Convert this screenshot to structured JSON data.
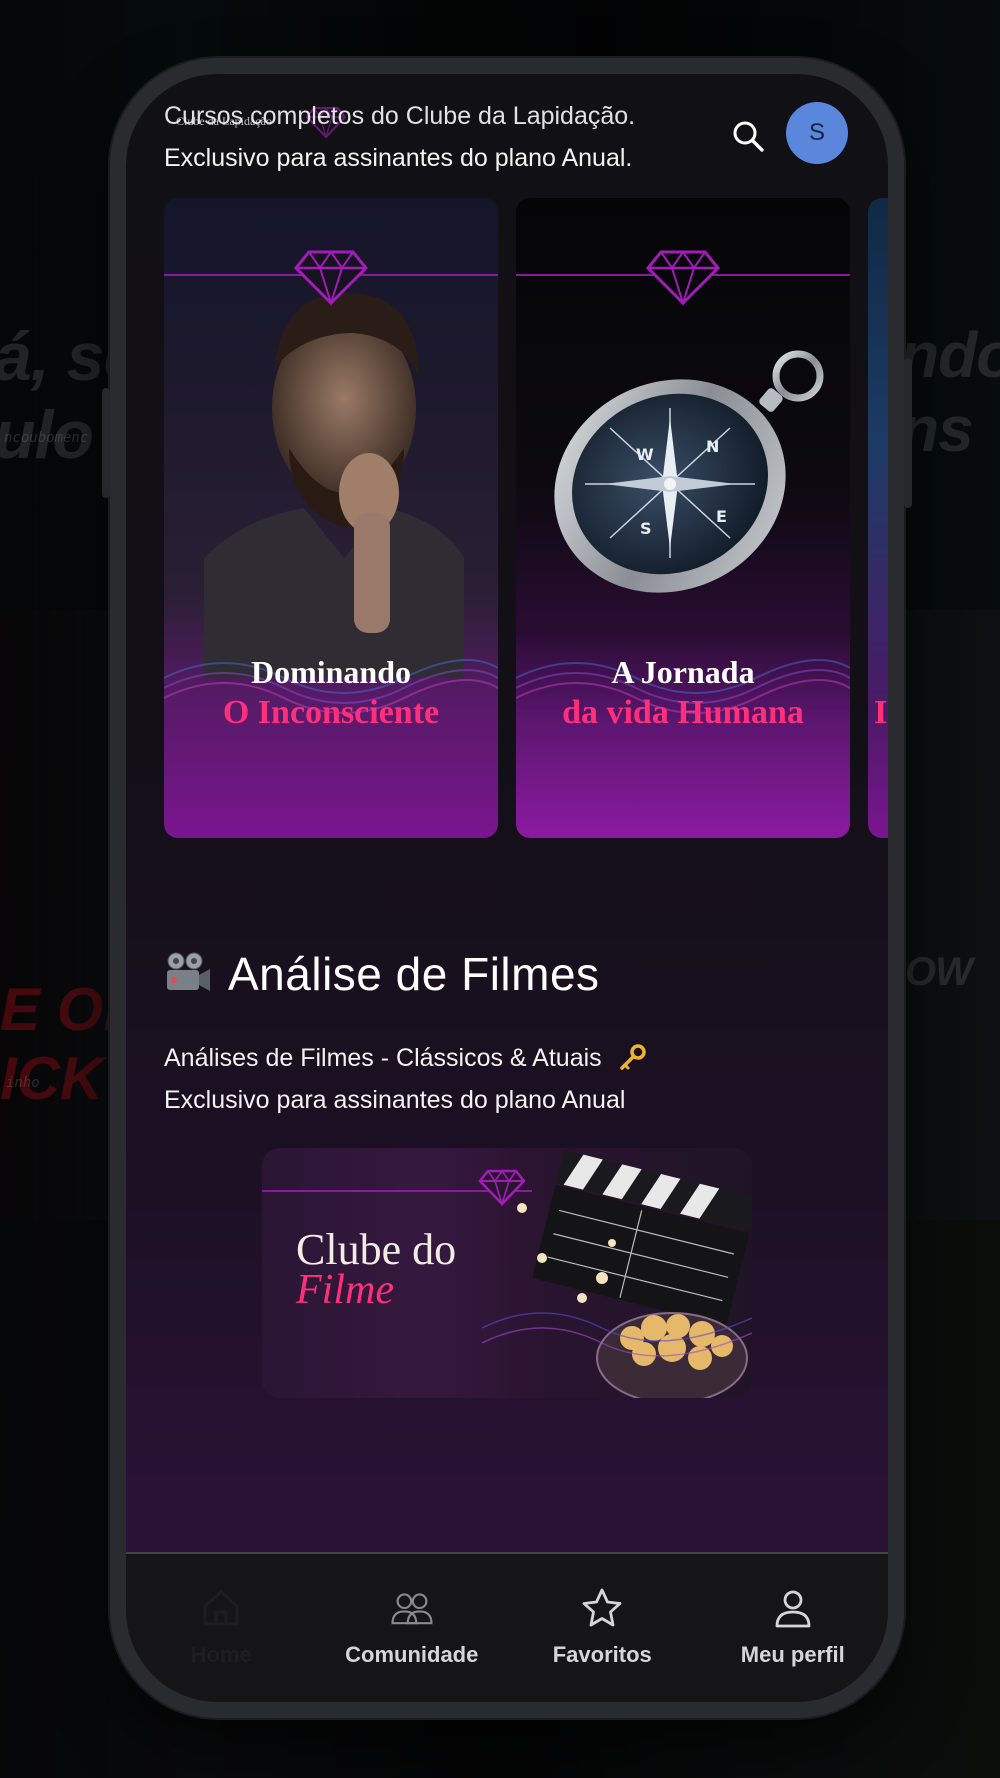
{
  "header": {
    "brand_logo_text": "Clube da Lapidação",
    "avatar_initial": "S"
  },
  "courses_section": {
    "subtitle_line1": "Cursos completos do Clube da Lapidação.",
    "subtitle_line2": "Exclusivo para assinantes do plano Anual.",
    "cards": [
      {
        "title_top": "Dominando",
        "title_bottom": "O Inconsciente"
      },
      {
        "title_top": "A Jornada",
        "title_bottom": "da vida Humana"
      },
      {
        "title_top": "",
        "title_bottom": "I"
      }
    ]
  },
  "films_section": {
    "title": "Análise de Filmes",
    "subtitle_line1": "Análises de Filmes - Clássicos & Atuais",
    "subtitle_line2": "Exclusivo para assinantes do plano Anual",
    "card": {
      "title_top": "Clube do",
      "title_bottom": "Filme"
    }
  },
  "bottom_nav": {
    "items": [
      {
        "label": "Home",
        "icon": "home-icon",
        "active": true
      },
      {
        "label": "Comunidade",
        "icon": "community-icon",
        "active": false
      },
      {
        "label": "Favoritos",
        "icon": "star-icon",
        "active": false
      },
      {
        "label": "Meu perfil",
        "icon": "profile-icon",
        "active": false
      }
    ]
  },
  "colors": {
    "accent_pink": "#ff2f7a",
    "accent_purple": "#8a1aa0",
    "avatar_bg": "#5a86dc"
  }
}
